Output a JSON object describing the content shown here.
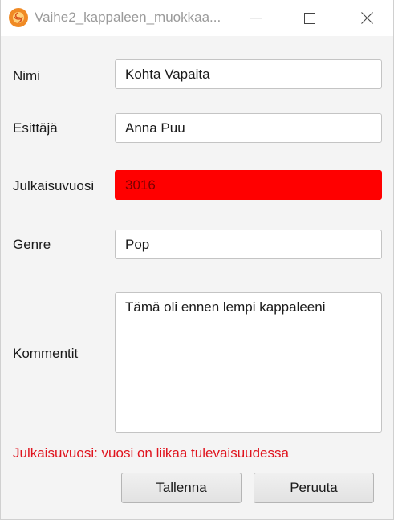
{
  "window": {
    "title": "Vaihe2_kappaleen_muokkaa..."
  },
  "icons": {
    "app": "rose-app-icon",
    "minimize": "minimize-icon",
    "maximize": "maximize-icon",
    "close": "close-icon"
  },
  "form": {
    "name_label": "Nimi",
    "name_value": "Kohta Vapaita",
    "artist_label": "Esittäjä",
    "artist_value": "Anna Puu",
    "year_label": "Julkaisuvuosi",
    "year_value": "3016",
    "genre_label": "Genre",
    "genre_value": "Pop",
    "comments_label": "Kommentit",
    "comments_value": "Tämä oli ennen lempi kappaleeni",
    "error_message": "Julkaisuvuosi: vuosi on liikaa tulevaisuudessa"
  },
  "buttons": {
    "save_label": "Tallenna",
    "cancel_label": "Peruuta"
  },
  "colors": {
    "error_field_background": "#ff0000",
    "error_text": "#e0141e",
    "app_icon": "#f08a24"
  }
}
